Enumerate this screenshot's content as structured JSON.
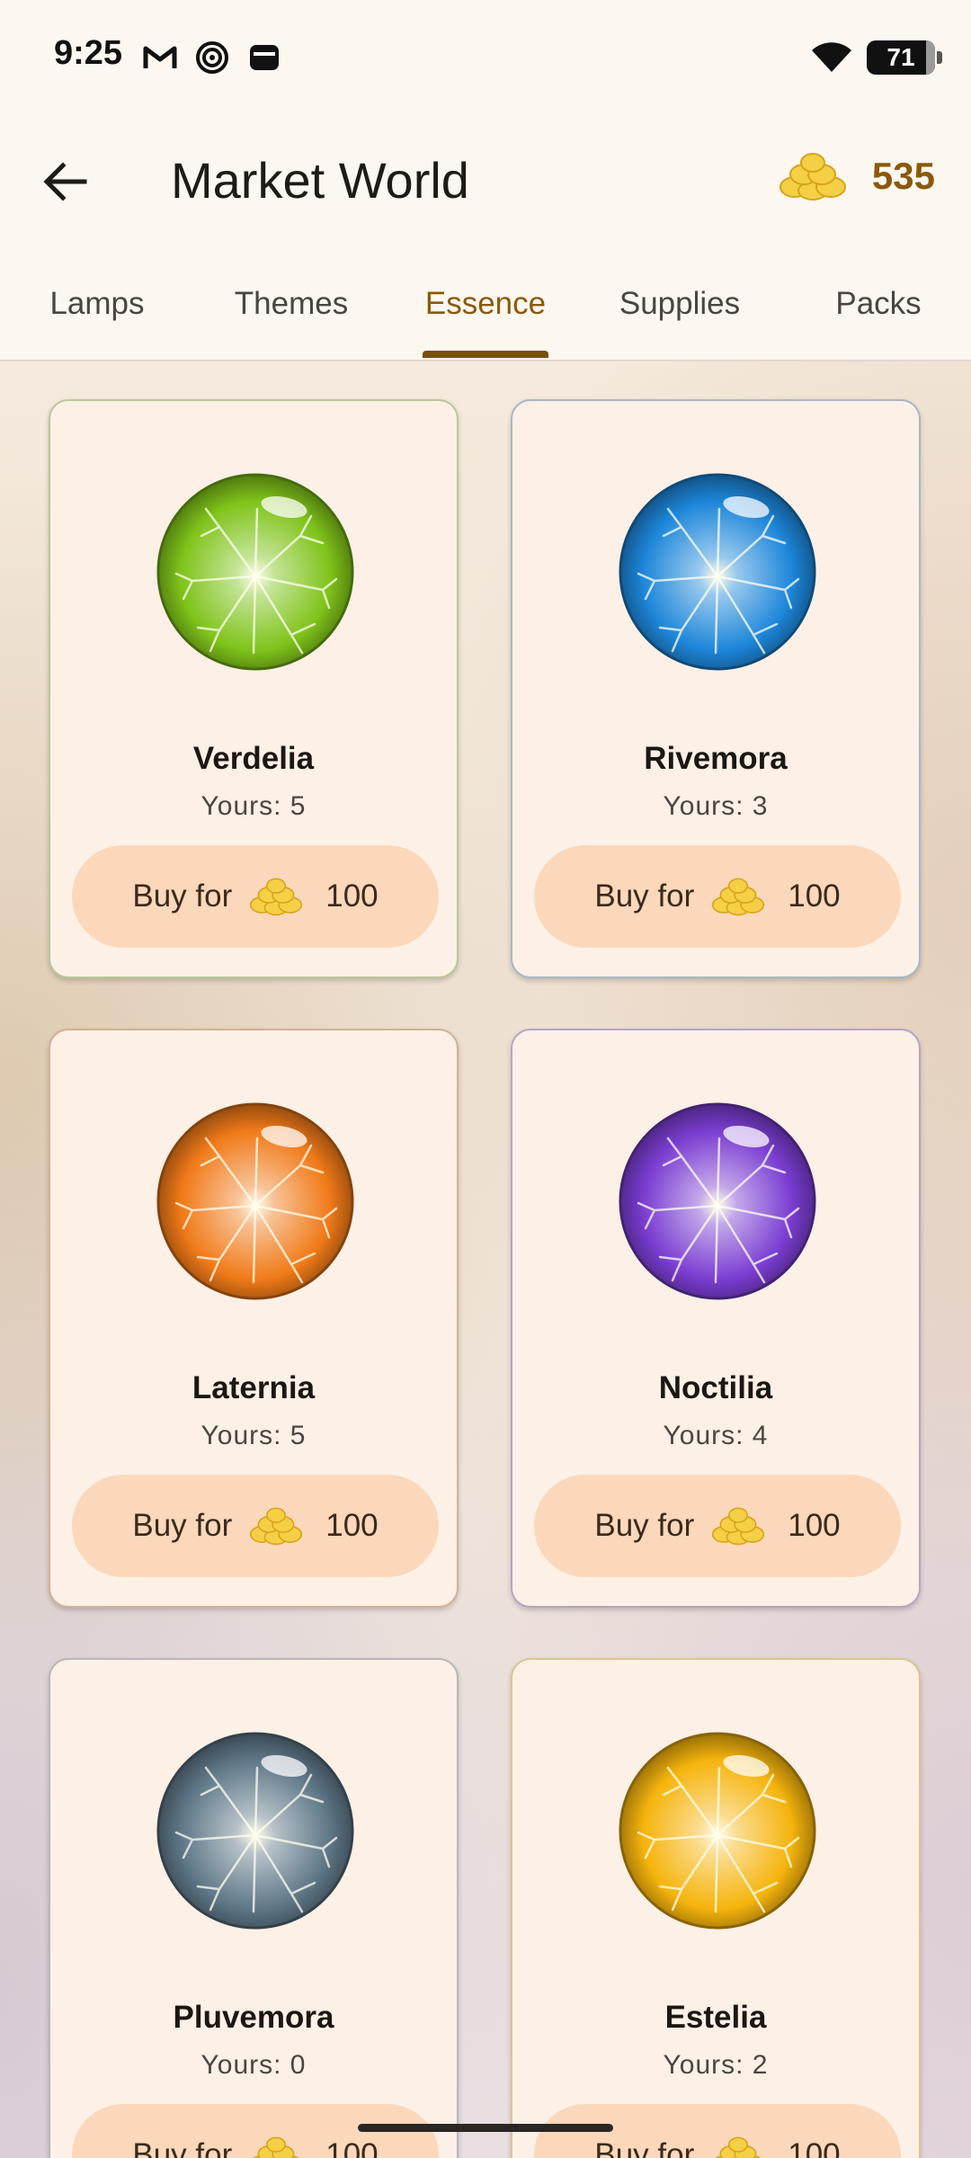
{
  "status_bar": {
    "time": "9:25",
    "battery": "71"
  },
  "app_bar": {
    "title": "Market World",
    "coin_balance": "535"
  },
  "tabs": [
    {
      "label": "Lamps",
      "active": false
    },
    {
      "label": "Themes",
      "active": false
    },
    {
      "label": "Essence",
      "active": true
    },
    {
      "label": "Supplies",
      "active": false
    },
    {
      "label": "Packs",
      "active": false
    }
  ],
  "items": [
    {
      "name": "Verdelia",
      "yours": "Yours: 5",
      "buy_label": "Buy for",
      "price": "100",
      "color": "#7fc31a",
      "border": "#b9c79a"
    },
    {
      "name": "Rivemora",
      "yours": "Yours: 3",
      "buy_label": "Buy for",
      "price": "100",
      "color": "#1d86d9",
      "border": "#a9b6c7"
    },
    {
      "name": "Laternia",
      "yours": "Yours: 5",
      "buy_label": "Buy for",
      "price": "100",
      "color": "#f07a18",
      "border": "#d2b195"
    },
    {
      "name": "Noctilia",
      "yours": "Yours: 4",
      "buy_label": "Buy for",
      "price": "100",
      "color": "#7a3dd1",
      "border": "#b7a4c7"
    },
    {
      "name": "Pluvemora",
      "yours": "Yours: 0",
      "buy_label": "Buy for",
      "price": "100",
      "color": "#5e7787",
      "border": "#b9b6b9"
    },
    {
      "name": "Estelia",
      "yours": "Yours: 2",
      "buy_label": "Buy for",
      "price": "100",
      "color": "#f5b40c",
      "border": "#d8c590"
    }
  ]
}
